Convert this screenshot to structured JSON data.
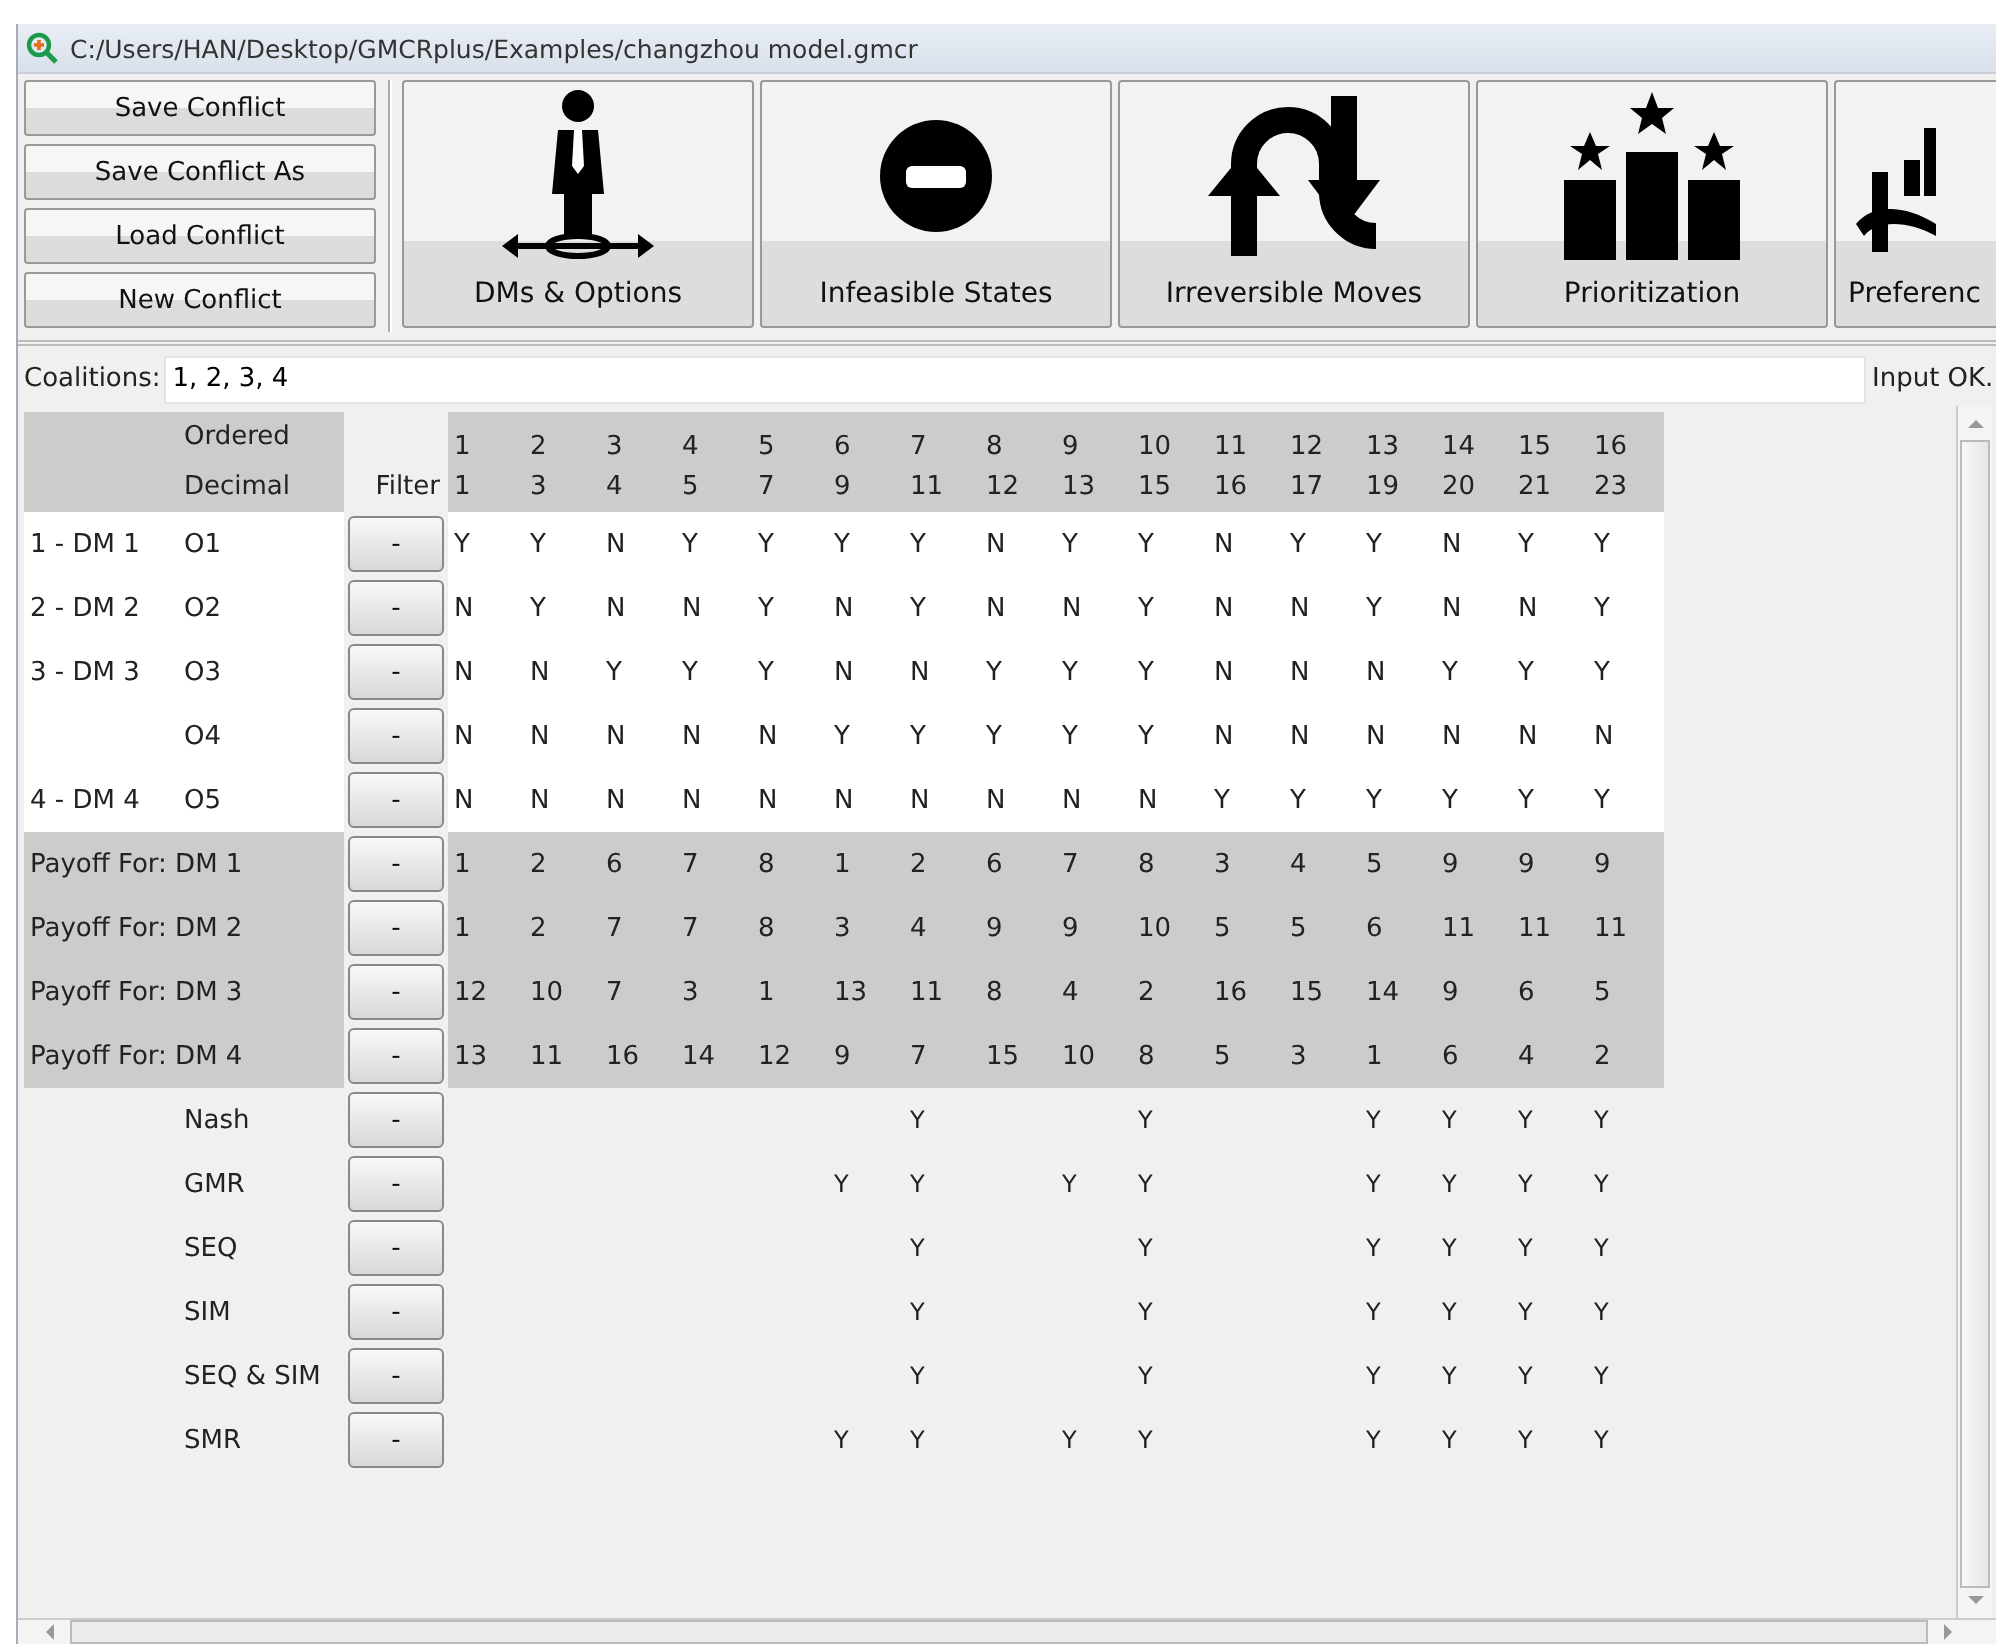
{
  "window": {
    "title": "C:/Users/HAN/Desktop/GMCRplus/Examples/changzhou model.gmcr"
  },
  "file_buttons": [
    "Save Conflict",
    "Save Conflict As",
    "Load Conflict",
    "New Conflict"
  ],
  "tool_buttons": [
    {
      "kind": "person",
      "label": "DMs & Options"
    },
    {
      "kind": "noentry",
      "label": "Infeasible States"
    },
    {
      "kind": "loop",
      "label": "Irreversible Moves"
    },
    {
      "kind": "podium",
      "label": "Prioritization"
    },
    {
      "kind": "chart",
      "label": "Preferenc"
    }
  ],
  "coalitions": {
    "label": "Coalitions:",
    "value": "1, 2, 3, 4",
    "status": "Input OK."
  },
  "table": {
    "ordered_label": "Ordered",
    "decimal_label": "Decimal",
    "filter_label": "Filter",
    "ordered": [
      "1",
      "2",
      "3",
      "4",
      "5",
      "6",
      "7",
      "8",
      "9",
      "10",
      "11",
      "12",
      "13",
      "14",
      "15",
      "16"
    ],
    "decimal": [
      "1",
      "3",
      "4",
      "5",
      "7",
      "9",
      "11",
      "12",
      "13",
      "15",
      "16",
      "17",
      "19",
      "20",
      "21",
      "23"
    ],
    "rows": [
      {
        "kind": "option",
        "dm": "1 - DM 1",
        "name": "O1",
        "filter": "-",
        "cells": [
          "Y",
          "Y",
          "N",
          "Y",
          "Y",
          "Y",
          "Y",
          "N",
          "Y",
          "Y",
          "N",
          "Y",
          "Y",
          "N",
          "Y",
          "Y"
        ]
      },
      {
        "kind": "option",
        "dm": "2 - DM 2",
        "name": "O2",
        "filter": "-",
        "cells": [
          "N",
          "Y",
          "N",
          "N",
          "Y",
          "N",
          "Y",
          "N",
          "N",
          "Y",
          "N",
          "N",
          "Y",
          "N",
          "N",
          "Y"
        ]
      },
      {
        "kind": "option",
        "dm": "3 - DM 3",
        "name": "O3",
        "filter": "-",
        "cells": [
          "N",
          "N",
          "Y",
          "Y",
          "Y",
          "N",
          "N",
          "Y",
          "Y",
          "Y",
          "N",
          "N",
          "N",
          "Y",
          "Y",
          "Y"
        ]
      },
      {
        "kind": "option",
        "name": "O4",
        "filter": "-",
        "cells": [
          "N",
          "N",
          "N",
          "N",
          "N",
          "Y",
          "Y",
          "Y",
          "Y",
          "Y",
          "N",
          "N",
          "N",
          "N",
          "N",
          "N"
        ]
      },
      {
        "kind": "option",
        "dm": "4 - DM 4",
        "name": "O5",
        "filter": "-",
        "cells": [
          "N",
          "N",
          "N",
          "N",
          "N",
          "N",
          "N",
          "N",
          "N",
          "N",
          "Y",
          "Y",
          "Y",
          "Y",
          "Y",
          "Y"
        ]
      },
      {
        "kind": "payoff",
        "name": "Payoff For: DM 1",
        "filter": "-",
        "cells": [
          "1",
          "2",
          "6",
          "7",
          "8",
          "1",
          "2",
          "6",
          "7",
          "8",
          "3",
          "4",
          "5",
          "9",
          "9",
          "9"
        ]
      },
      {
        "kind": "payoff",
        "name": "Payoff For: DM 2",
        "filter": "-",
        "cells": [
          "1",
          "2",
          "7",
          "7",
          "8",
          "3",
          "4",
          "9",
          "9",
          "10",
          "5",
          "5",
          "6",
          "11",
          "11",
          "11"
        ]
      },
      {
        "kind": "payoff",
        "name": "Payoff For: DM 3",
        "filter": "-",
        "cells": [
          "12",
          "10",
          "7",
          "3",
          "1",
          "13",
          "11",
          "8",
          "4",
          "2",
          "16",
          "15",
          "14",
          "9",
          "6",
          "5"
        ]
      },
      {
        "kind": "payoff",
        "name": "Payoff For: DM 4",
        "filter": "-",
        "cells": [
          "13",
          "11",
          "16",
          "14",
          "12",
          "9",
          "7",
          "15",
          "10",
          "8",
          "5",
          "3",
          "1",
          "6",
          "4",
          "2"
        ]
      },
      {
        "kind": "solution",
        "name": "Nash",
        "filter": "-",
        "cells": [
          null,
          null,
          null,
          null,
          null,
          null,
          "Y",
          null,
          null,
          "Y",
          null,
          null,
          "Y",
          "Y",
          "Y",
          "Y"
        ]
      },
      {
        "kind": "solution",
        "name": "GMR",
        "filter": "-",
        "cells": [
          null,
          null,
          null,
          null,
          null,
          "Y",
          "Y",
          null,
          "Y",
          "Y",
          null,
          null,
          "Y",
          "Y",
          "Y",
          "Y"
        ]
      },
      {
        "kind": "solution",
        "name": "SEQ",
        "filter": "-",
        "cells": [
          null,
          null,
          null,
          null,
          null,
          null,
          "Y",
          null,
          null,
          "Y",
          null,
          null,
          "Y",
          "Y",
          "Y",
          "Y"
        ]
      },
      {
        "kind": "solution",
        "name": "SIM",
        "filter": "-",
        "cells": [
          null,
          null,
          null,
          null,
          null,
          null,
          "Y",
          null,
          null,
          "Y",
          null,
          null,
          "Y",
          "Y",
          "Y",
          "Y"
        ]
      },
      {
        "kind": "solution",
        "name": "SEQ & SIM",
        "filter": "-",
        "cells": [
          null,
          null,
          null,
          null,
          null,
          null,
          "Y",
          null,
          null,
          "Y",
          null,
          null,
          "Y",
          "Y",
          "Y",
          "Y"
        ]
      },
      {
        "kind": "solution",
        "name": "SMR",
        "filter": "-",
        "cells": [
          null,
          null,
          null,
          null,
          null,
          "Y",
          "Y",
          null,
          "Y",
          "Y",
          null,
          null,
          "Y",
          "Y",
          "Y",
          "Y"
        ]
      }
    ]
  }
}
